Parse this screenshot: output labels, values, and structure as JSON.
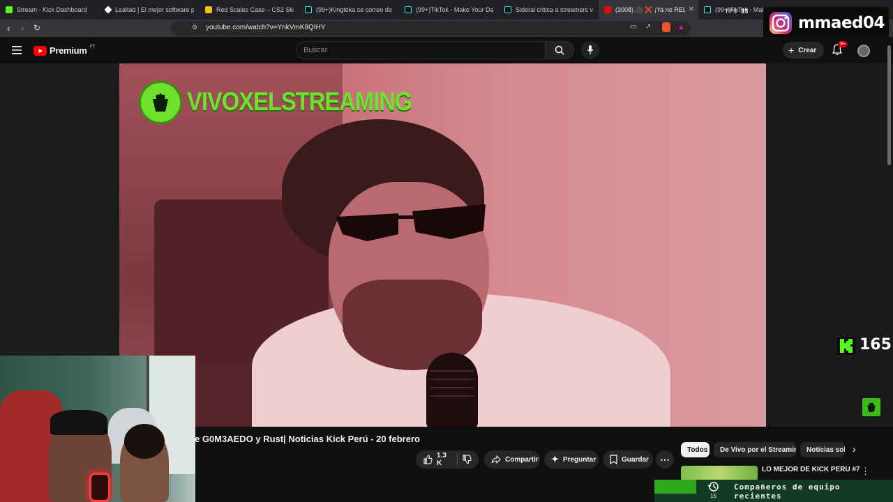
{
  "browser": {
    "tabs": [
      {
        "title": "Stream - Kick Dashboard",
        "favicon_color": "#53fc18"
      },
      {
        "title": "Lealtad | El mejor software para",
        "favicon_color": "#ffffff"
      },
      {
        "title": "Red Scales Case – CS2 Skin Ca",
        "favicon_color": "#f2c21b"
      },
      {
        "title": "(99+)Kingteka se correo de Sa",
        "favicon_color": "#111111"
      },
      {
        "title": "(99+)TikTok - Make Your Day",
        "favicon_color": "#111111"
      },
      {
        "title": "Sideral critica a streamers vend",
        "favicon_color": "#111111"
      },
      {
        "title": "(3008) 🎥 ❌ ¡Ya no RELIN",
        "favicon_color": "#ff0000"
      },
      {
        "title": "(99+)TikTok - Make Y",
        "favicon_color": "#111111"
      }
    ],
    "url": "youtube.com/watch?v=YnkVmK8QIHY"
  },
  "youtube": {
    "logo_text": "Premium",
    "region": "PE",
    "search_placeholder": "Buscar",
    "create_label": "Crear",
    "notification_count": "9+",
    "video_title": "e G0M3AEDO y Rust| Noticias Kick Perú - 20 febrero",
    "like_count": "1.3 K",
    "share_label": "Compartir",
    "ask_label": "Preguntar",
    "save_label": "Guardar",
    "chips": [
      "Todos",
      "De Vivo por el Streaming",
      "Noticias sob"
    ],
    "related_title": "LO MEJOR DE KICK PERU #7"
  },
  "overlay": {
    "brand_name": "VIVOXELSTREAMING",
    "instagram_handle": "mmaed04",
    "fps_label": "FPS",
    "fps_value": "33",
    "kick_viewers": "165",
    "bottom_label": "Compañeros de equipo recientes",
    "bottom_count": "15"
  },
  "colors": {
    "kick_green": "#53fc18",
    "youtube_red": "#ff0000",
    "background": "#0f0f0f"
  }
}
